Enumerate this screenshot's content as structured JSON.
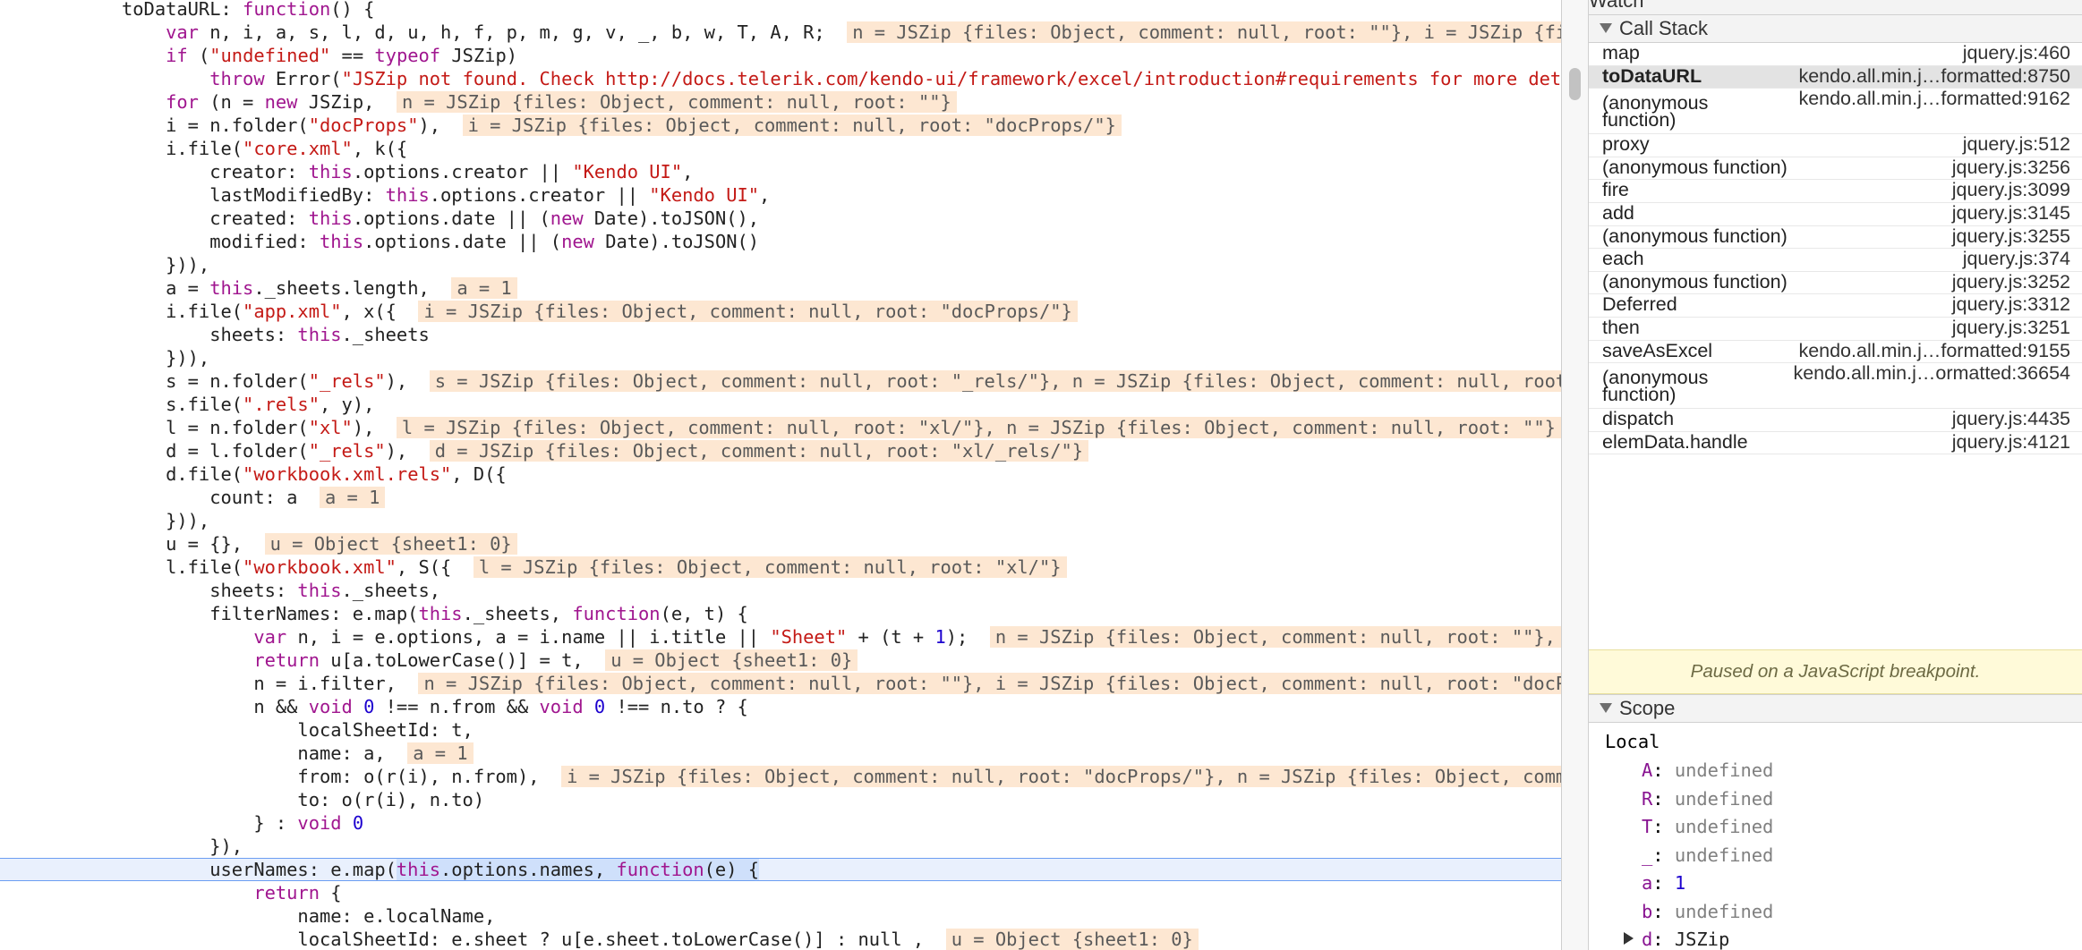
{
  "code": {
    "lines": [
      [
        {
          "t": "toDataURL: "
        },
        {
          "t": "function",
          "c": "kw"
        },
        {
          "t": "() {"
        }
      ],
      [
        {
          "t": "    "
        },
        {
          "t": "var",
          "c": "kw"
        },
        {
          "t": " n, i, a, s, l, d, u, h, f, p, m, g, v, _, b, w, T, A, R;  "
        },
        {
          "t": "n = JSZip {files: Object, comment: null, root: \"\"}, i = JSZip {files: Object, comment: null",
          "c": "val"
        }
      ],
      [
        {
          "t": "    "
        },
        {
          "t": "if",
          "c": "kw"
        },
        {
          "t": " ("
        },
        {
          "t": "\"undefined\"",
          "c": "str"
        },
        {
          "t": " == "
        },
        {
          "t": "typeof",
          "c": "kw"
        },
        {
          "t": " JSZip)"
        }
      ],
      [
        {
          "t": "        "
        },
        {
          "t": "throw",
          "c": "kw"
        },
        {
          "t": " Error("
        },
        {
          "t": "\"JSZip not found. Check http://docs.telerik.com/kendo-ui/framework/excel/introduction#requirements for more details.\"",
          "c": "str"
        },
        {
          "t": ");"
        }
      ],
      [
        {
          "t": "    "
        },
        {
          "t": "for",
          "c": "kw"
        },
        {
          "t": " (n = "
        },
        {
          "t": "new",
          "c": "kw"
        },
        {
          "t": " JSZip,  "
        },
        {
          "t": "n = JSZip {files: Object, comment: null, root: \"\"}",
          "c": "val"
        }
      ],
      [
        {
          "t": "    i = n.folder("
        },
        {
          "t": "\"docProps\"",
          "c": "str"
        },
        {
          "t": "),  "
        },
        {
          "t": "i = JSZip {files: Object, comment: null, root: \"docProps/\"}",
          "c": "val"
        }
      ],
      [
        {
          "t": "    i.file("
        },
        {
          "t": "\"core.xml\"",
          "c": "str"
        },
        {
          "t": ", k({"
        }
      ],
      [
        {
          "t": "        creator: "
        },
        {
          "t": "this",
          "c": "kw"
        },
        {
          "t": ".options.creator || "
        },
        {
          "t": "\"Kendo UI\"",
          "c": "str"
        },
        {
          "t": ","
        }
      ],
      [
        {
          "t": "        lastModifiedBy: "
        },
        {
          "t": "this",
          "c": "kw"
        },
        {
          "t": ".options.creator || "
        },
        {
          "t": "\"Kendo UI\"",
          "c": "str"
        },
        {
          "t": ","
        }
      ],
      [
        {
          "t": "        created: "
        },
        {
          "t": "this",
          "c": "kw"
        },
        {
          "t": ".options.date || ("
        },
        {
          "t": "new",
          "c": "kw"
        },
        {
          "t": " Date).toJSON(),"
        }
      ],
      [
        {
          "t": "        modified: "
        },
        {
          "t": "this",
          "c": "kw"
        },
        {
          "t": ".options.date || ("
        },
        {
          "t": "new",
          "c": "kw"
        },
        {
          "t": " Date).toJSON()"
        }
      ],
      [
        {
          "t": "    })),"
        }
      ],
      [
        {
          "t": "    a = "
        },
        {
          "t": "this",
          "c": "kw"
        },
        {
          "t": "._sheets.length,  "
        },
        {
          "t": "a = 1",
          "c": "val"
        }
      ],
      [
        {
          "t": "    i.file("
        },
        {
          "t": "\"app.xml\"",
          "c": "str"
        },
        {
          "t": ", x({  "
        },
        {
          "t": "i = JSZip {files: Object, comment: null, root: \"docProps/\"}",
          "c": "val"
        }
      ],
      [
        {
          "t": "        sheets: "
        },
        {
          "t": "this",
          "c": "kw"
        },
        {
          "t": "._sheets"
        }
      ],
      [
        {
          "t": "    })),"
        }
      ],
      [
        {
          "t": "    s = n.folder("
        },
        {
          "t": "\"_rels\"",
          "c": "str"
        },
        {
          "t": "),  "
        },
        {
          "t": "s = JSZip {files: Object, comment: null, root: \"_rels/\"}, n = JSZip {files: Object, comment: null, root: \"\"}",
          "c": "val"
        }
      ],
      [
        {
          "t": "    s.file("
        },
        {
          "t": "\".rels\"",
          "c": "str"
        },
        {
          "t": ", y),"
        }
      ],
      [
        {
          "t": "    l = n.folder("
        },
        {
          "t": "\"xl\"",
          "c": "str"
        },
        {
          "t": "),  "
        },
        {
          "t": "l = JSZip {files: Object, comment: null, root: \"xl/\"}, n = JSZip {files: Object, comment: null, root: \"\"}",
          "c": "val"
        }
      ],
      [
        {
          "t": "    d = l.folder("
        },
        {
          "t": "\"_rels\"",
          "c": "str"
        },
        {
          "t": "),  "
        },
        {
          "t": "d = JSZip {files: Object, comment: null, root: \"xl/_rels/\"}",
          "c": "val"
        }
      ],
      [
        {
          "t": "    d.file("
        },
        {
          "t": "\"workbook.xml.rels\"",
          "c": "str"
        },
        {
          "t": ", D({"
        }
      ],
      [
        {
          "t": "        count: a  "
        },
        {
          "t": "a = 1",
          "c": "val"
        }
      ],
      [
        {
          "t": "    })),"
        }
      ],
      [
        {
          "t": "    u = {},  "
        },
        {
          "t": "u = Object {sheet1: 0}",
          "c": "val"
        }
      ],
      [
        {
          "t": "    l.file("
        },
        {
          "t": "\"workbook.xml\"",
          "c": "str"
        },
        {
          "t": ", S({  "
        },
        {
          "t": "l = JSZip {files: Object, comment: null, root: \"xl/\"}",
          "c": "val"
        }
      ],
      [
        {
          "t": "        sheets: "
        },
        {
          "t": "this",
          "c": "kw"
        },
        {
          "t": "._sheets,"
        }
      ],
      [
        {
          "t": "        filterNames: e.map("
        },
        {
          "t": "this",
          "c": "kw"
        },
        {
          "t": "._sheets, "
        },
        {
          "t": "function",
          "c": "kw"
        },
        {
          "t": "(e, t) {"
        }
      ],
      [
        {
          "t": "            "
        },
        {
          "t": "var",
          "c": "kw"
        },
        {
          "t": " n, i = e.options, a = i.name || i.title || "
        },
        {
          "t": "\"Sheet\"",
          "c": "str"
        },
        {
          "t": " + (t + "
        },
        {
          "t": "1",
          "c": "num"
        },
        {
          "t": ");  "
        },
        {
          "t": "n = JSZip {files: Object, comment: null, root: \"\"}, i = JSZip",
          "c": "val"
        }
      ],
      [
        {
          "t": "            "
        },
        {
          "t": "return",
          "c": "kw"
        },
        {
          "t": " u[a.toLowerCase()] = t,  "
        },
        {
          "t": "u = Object {sheet1: 0}",
          "c": "val"
        }
      ],
      [
        {
          "t": "            n = i.filter,  "
        },
        {
          "t": "n = JSZip {files: Object, comment: null, root: \"\"}, i = JSZip {files: Object, comment: null, root: \"docProps/\"}",
          "c": "val"
        }
      ],
      [
        {
          "t": "            n && "
        },
        {
          "t": "void",
          "c": "kw"
        },
        {
          "t": " "
        },
        {
          "t": "0",
          "c": "num"
        },
        {
          "t": " !== n.from && "
        },
        {
          "t": "void",
          "c": "kw"
        },
        {
          "t": " "
        },
        {
          "t": "0",
          "c": "num"
        },
        {
          "t": " !== n.to ? {"
        }
      ],
      [
        {
          "t": "                localSheetId: t,"
        }
      ],
      [
        {
          "t": "                name: a,  "
        },
        {
          "t": "a = 1",
          "c": "val"
        }
      ],
      [
        {
          "t": "                from: o(r(i), n.from),  "
        },
        {
          "t": "i = JSZip {files: Object, comment: null, root: \"docProps/\"}, n = JSZip {files: Object, comment: null, root: \"\"}",
          "c": "val"
        }
      ],
      [
        {
          "t": "                to: o(r(i), n.to)"
        }
      ],
      [
        {
          "t": "            } : "
        },
        {
          "t": "void",
          "c": "kw"
        },
        {
          "t": " "
        },
        {
          "t": "0",
          "c": "num"
        }
      ],
      [
        {
          "t": "        }),"
        }
      ],
      [
        {
          "t": "        userNames: e.map("
        },
        {
          "t": "this",
          "c": "kw",
          "sel": true
        },
        {
          "t": ".options.names, ",
          "sel": true
        },
        {
          "t": "function",
          "c": "kw",
          "sel": true
        },
        {
          "t": "(e) {",
          "sel": true
        }
      ],
      [
        {
          "t": "            "
        },
        {
          "t": "return",
          "c": "kw"
        },
        {
          "t": " {"
        }
      ],
      [
        {
          "t": "                name: e.localName,"
        }
      ],
      [
        {
          "t": "                localSheetId: e.sheet ? u[e.sheet.toLowerCase()] : null ,  "
        },
        {
          "t": "u = Object {sheet1: 0}",
          "c": "val"
        }
      ]
    ],
    "active_line_index": 37
  },
  "sidebar": {
    "watch_label": "Watch",
    "call_stack_label": "Call Stack",
    "call_stack": [
      {
        "fn": "map",
        "loc": "jquery.js:460"
      },
      {
        "fn": "toDataURL",
        "loc": "kendo.all.min.j…formatted:8750",
        "selected": true
      },
      {
        "fn": "(anonymous function)",
        "loc": "kendo.all.min.j…formatted:9162",
        "tall": true
      },
      {
        "fn": "proxy",
        "loc": "jquery.js:512"
      },
      {
        "fn": "(anonymous function)",
        "loc": "jquery.js:3256"
      },
      {
        "fn": "fire",
        "loc": "jquery.js:3099"
      },
      {
        "fn": "add",
        "loc": "jquery.js:3145"
      },
      {
        "fn": "(anonymous function)",
        "loc": "jquery.js:3255"
      },
      {
        "fn": "each",
        "loc": "jquery.js:374"
      },
      {
        "fn": "(anonymous function)",
        "loc": "jquery.js:3252"
      },
      {
        "fn": "Deferred",
        "loc": "jquery.js:3312"
      },
      {
        "fn": "then",
        "loc": "jquery.js:3251"
      },
      {
        "fn": "saveAsExcel",
        "loc": "kendo.all.min.j…formatted:9155"
      },
      {
        "fn": "(anonymous function)",
        "loc": "kendo.all.min.j…ormatted:36654",
        "tall": true
      },
      {
        "fn": "dispatch",
        "loc": "jquery.js:4435"
      },
      {
        "fn": "elemData.handle",
        "loc": "jquery.js:4121"
      }
    ],
    "paused_message": "Paused on a JavaScript breakpoint.",
    "scope_label": "Scope",
    "local_label": "Local",
    "scope_vars": [
      {
        "key": "A",
        "val": "undefined",
        "kind": "undef"
      },
      {
        "key": "R",
        "val": "undefined",
        "kind": "undef"
      },
      {
        "key": "T",
        "val": "undefined",
        "kind": "undef"
      },
      {
        "key": "_",
        "val": "undefined",
        "kind": "undef"
      },
      {
        "key": "a",
        "val": "1",
        "kind": "num"
      },
      {
        "key": "b",
        "val": "undefined",
        "kind": "undef"
      },
      {
        "key": "d",
        "val": "JSZip",
        "kind": "obj",
        "expandable": true
      }
    ]
  }
}
